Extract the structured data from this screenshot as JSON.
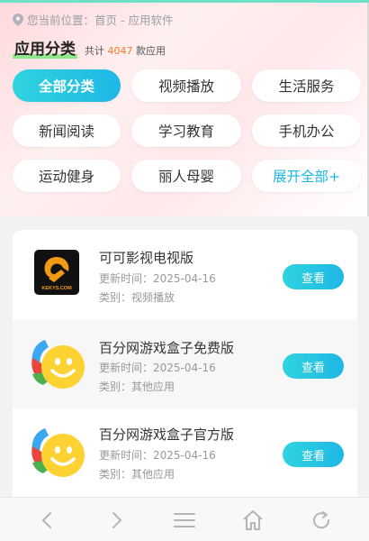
{
  "breadcrumb": {
    "text": "您当前位置：首页 - 应用软件"
  },
  "section": {
    "title": "应用分类",
    "count_prefix": "共计",
    "count_value": "4047",
    "count_suffix": "款应用"
  },
  "categories": [
    {
      "label": "全部分类",
      "active": true
    },
    {
      "label": "视频播放"
    },
    {
      "label": "生活服务"
    },
    {
      "label": "新闻阅读"
    },
    {
      "label": "学习教育"
    },
    {
      "label": "手机办公"
    },
    {
      "label": "运动健身"
    },
    {
      "label": "丽人母婴"
    },
    {
      "label": "展开全部+"
    }
  ],
  "apps": [
    {
      "name": "可可影视电视版",
      "update": "更新时间：2025-04-16",
      "category": "类别：视频播放",
      "button": "查看",
      "icon": "kekys-logo-icon",
      "icon_text": "KEKYS.COM"
    },
    {
      "name": "百分网游戏盒子免费版",
      "update": "更新时间：2025-04-16",
      "category": "类别：其他应用",
      "button": "查看",
      "icon": "smiley-logo-icon"
    },
    {
      "name": "百分网游戏盒子官方版",
      "update": "更新时间：2025-04-16",
      "category": "类别：其他应用",
      "button": "查看",
      "icon": "smiley-logo-icon"
    }
  ],
  "colors": {
    "accent": "#1fb7e6",
    "count": "#ff7a29",
    "highlight": "#8ee88a"
  },
  "navbar": [
    "back-icon",
    "forward-icon",
    "menu-icon",
    "home-icon",
    "refresh-icon"
  ]
}
